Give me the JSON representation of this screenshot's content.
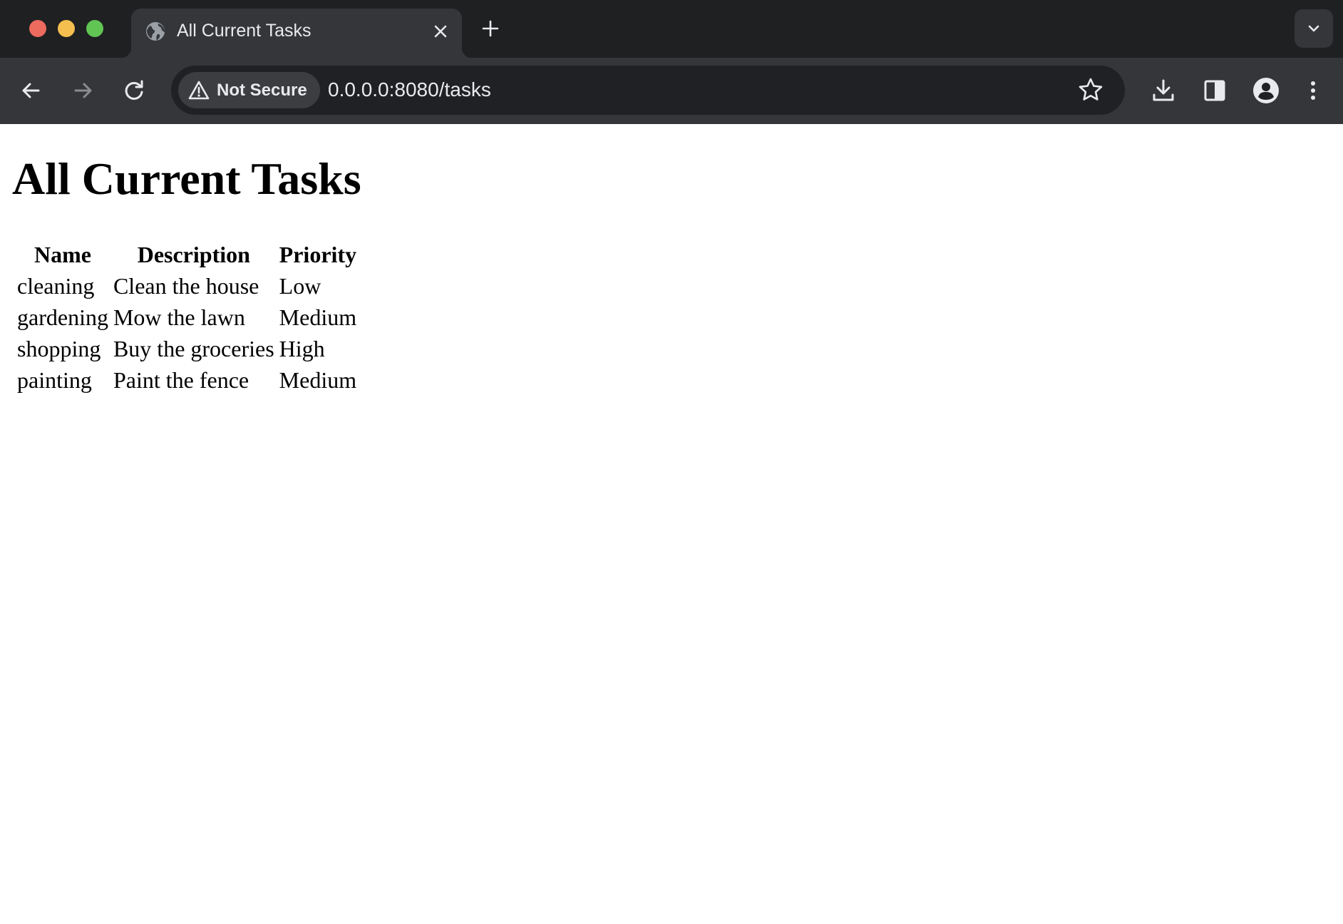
{
  "browser": {
    "tab": {
      "title": "All Current Tasks",
      "favicon": "globe-icon"
    },
    "address_bar": {
      "security_label": "Not Secure",
      "url": "0.0.0.0:8080/tasks"
    },
    "colors": {
      "tabstrip": "#1f2022",
      "toolbar": "#35363a",
      "omnibox": "#202124",
      "text": "#e8eaed"
    }
  },
  "page": {
    "title": "All Current Tasks",
    "table": {
      "headers": [
        "Name",
        "Description",
        "Priority"
      ],
      "rows": [
        [
          "cleaning",
          "Clean the house",
          "Low"
        ],
        [
          "gardening",
          "Mow the lawn",
          "Medium"
        ],
        [
          "shopping",
          "Buy the groceries",
          "High"
        ],
        [
          "painting",
          "Paint the fence",
          "Medium"
        ]
      ]
    }
  }
}
